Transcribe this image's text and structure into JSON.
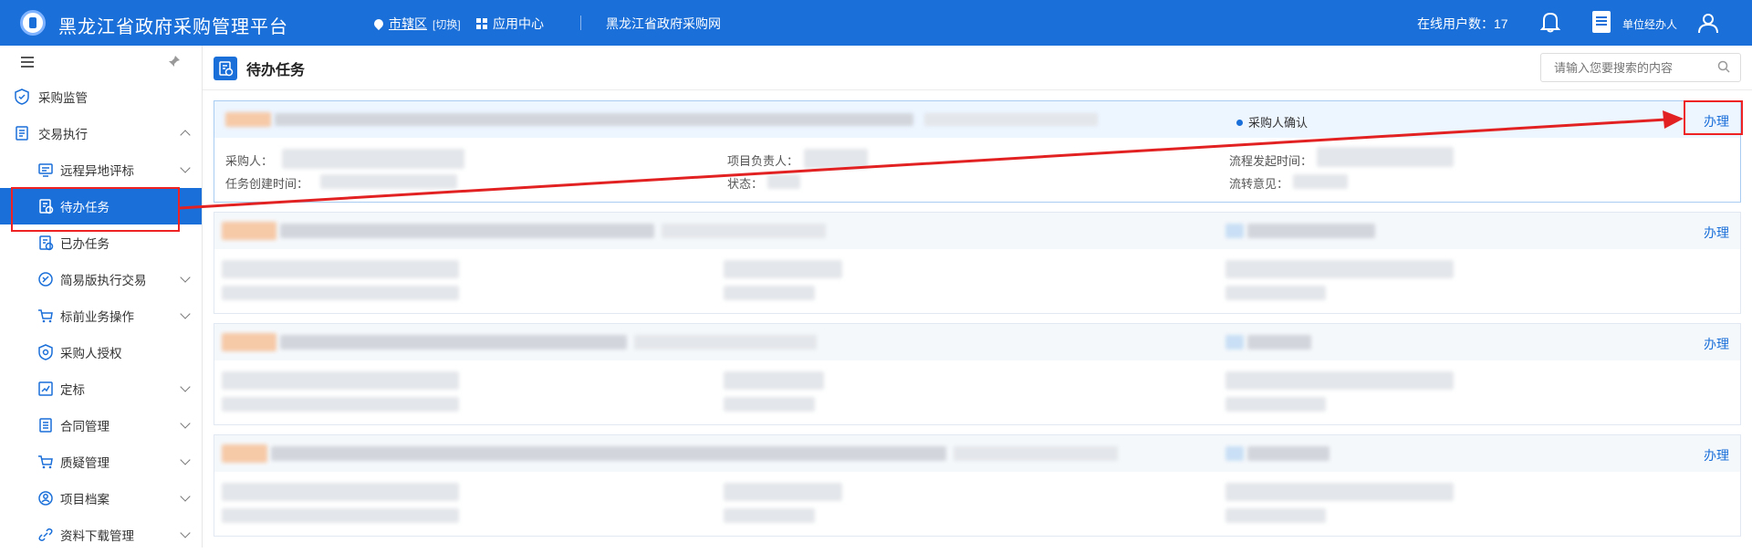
{
  "header": {
    "title": "黑龙江省政府采购管理平台",
    "location": "市辖区",
    "location_switch": "[切换]",
    "app_center": "应用中心",
    "gov_site": "黑龙江省政府采购网",
    "online_users": "在线用户数：17",
    "unit_agent": "单位经办人",
    "icons": [
      "logo-icon",
      "location-icon",
      "apps-icon",
      "bell-icon",
      "unit-icon",
      "user-icon"
    ]
  },
  "sidebar": {
    "items": [
      {
        "label": "采购监管",
        "icon": "shield-icon",
        "level": 1,
        "expand": "none",
        "active": false
      },
      {
        "label": "交易执行",
        "icon": "document-icon",
        "level": 1,
        "expand": "up",
        "active": false
      },
      {
        "label": "远程异地评标",
        "icon": "monitor-icon",
        "level": 2,
        "expand": "down",
        "active": false
      },
      {
        "label": "待办任务",
        "icon": "todo-icon",
        "level": 2,
        "expand": "none",
        "active": true
      },
      {
        "label": "已办任务",
        "icon": "done-icon",
        "level": 2,
        "expand": "none",
        "active": false
      },
      {
        "label": "简易版执行交易",
        "icon": "simple-trade-icon",
        "level": 2,
        "expand": "down",
        "active": false
      },
      {
        "label": "标前业务操作",
        "icon": "cart-icon",
        "level": 2,
        "expand": "down",
        "active": false
      },
      {
        "label": "采购人授权",
        "icon": "authorize-icon",
        "level": 2,
        "expand": "none",
        "active": false
      },
      {
        "label": "定标",
        "icon": "award-icon",
        "level": 2,
        "expand": "down",
        "active": false
      },
      {
        "label": "合同管理",
        "icon": "contract-icon",
        "level": 2,
        "expand": "down",
        "active": false
      },
      {
        "label": "质疑管理",
        "icon": "question-cart-icon",
        "level": 2,
        "expand": "down",
        "active": false
      },
      {
        "label": "项目档案",
        "icon": "archive-icon",
        "level": 2,
        "expand": "down",
        "active": false
      },
      {
        "label": "资料下载管理",
        "icon": "link-icon",
        "level": 2,
        "expand": "down",
        "active": false
      }
    ]
  },
  "main": {
    "page_title": "待办任务",
    "search_placeholder": "请输入您要搜索的内容",
    "cards": [
      {
        "status": "采购人确认",
        "action": "办理",
        "labels": {
          "purchaser": "采购人：",
          "project_lead": "项目负责人：",
          "flow_start": "流程发起时间：",
          "task_created": "任务创建时间：",
          "state": "状态：",
          "flow_opinion": "流转意见："
        }
      },
      {
        "action": "办理"
      },
      {
        "action": "办理"
      },
      {
        "action": "办理"
      }
    ]
  },
  "colors": {
    "primary": "#1a6fd9",
    "annotation": "#e22222"
  }
}
